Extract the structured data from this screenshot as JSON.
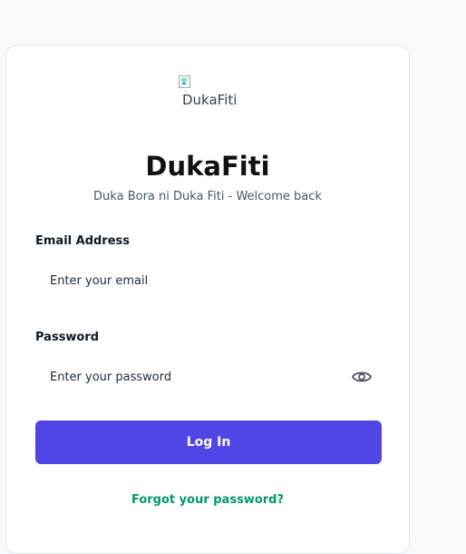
{
  "brand": {
    "logo_alt": "DukaFiti",
    "title": "DukaFiti",
    "tagline": "Duka Bora ni Duka Fiti - Welcome back"
  },
  "form": {
    "email_label": "Email Address",
    "email_placeholder": "Enter your email",
    "email_value": "",
    "password_label": "Password",
    "password_placeholder": "Enter your password",
    "password_value": "",
    "toggle_icon": "eye-icon",
    "submit_label": "Log In",
    "forgot_label": "Forgot your password?"
  },
  "colors": {
    "primary": "#4f46e5",
    "link": "#059669",
    "background": "#f8f9fb",
    "card": "#ffffff"
  }
}
